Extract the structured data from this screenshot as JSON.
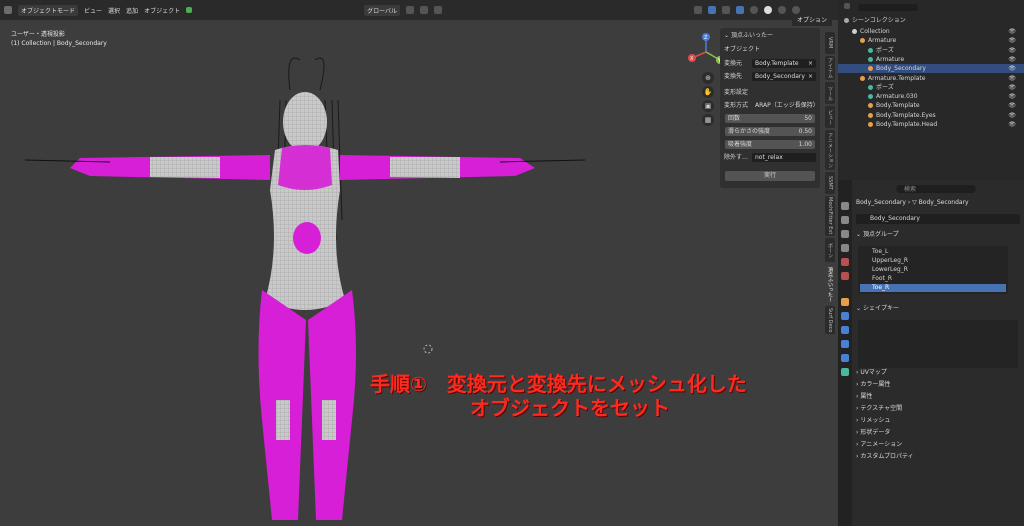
{
  "topbar": {
    "mode": "オブジェクトモード",
    "menus": [
      "ビュー",
      "選択",
      "追加",
      "オブジェクト"
    ],
    "transform": "グローバル",
    "options": "オプション"
  },
  "viewport": {
    "view_name": "ユーザー・透視投影",
    "collection_info": "(1) Collection | Body_Secondary"
  },
  "gizmo": {
    "z": "Z",
    "y": "Y",
    "x": "X"
  },
  "npanel": {
    "header": "頂点ふいったー",
    "object_label": "オブジェクト",
    "source_label": "変換元",
    "source_value": "Body.Template",
    "target_label": "変換先",
    "target_value": "Body_Secondary",
    "deform_label": "変形設定",
    "method_label": "変形方式",
    "method_value": "ARAP（エッジ長保持）",
    "sliders": [
      {
        "label": "回数",
        "value": "50"
      },
      {
        "label": "滑らかさの強度",
        "value": "0.50"
      },
      {
        "label": "吸着強度",
        "value": "1.00"
      }
    ],
    "exclude_label": "除外す…",
    "exclude_value": "not_relax",
    "execute": "実行"
  },
  "sidetabs": [
    "VRM",
    "アイテム",
    "ツール",
    "ビュー",
    "アニメーション",
    "SSMT",
    "MochiFitter Ext",
    "ボーン",
    "頂点ふいったー",
    "Surf Deco"
  ],
  "caption": {
    "line1": "手順①　変換元と変換先にメッシュ化した",
    "line2": "オブジェクトをセット"
  },
  "outliner": {
    "title": "シーンコレクション",
    "rows": [
      {
        "label": "Collection",
        "indent": 1,
        "color": "#d0d0d0"
      },
      {
        "label": "Armature",
        "indent": 2,
        "color": "#e6a04a"
      },
      {
        "label": "ポーズ",
        "indent": 3,
        "color": "#4ab8a0"
      },
      {
        "label": "Armature",
        "indent": 3,
        "color": "#4ab8a0"
      },
      {
        "label": "Body_Secondary",
        "indent": 3,
        "color": "#e6a04a",
        "selected": true
      },
      {
        "label": "Armature.Template",
        "indent": 2,
        "color": "#e6a04a"
      },
      {
        "label": "ポーズ",
        "indent": 3,
        "color": "#4ab8a0"
      },
      {
        "label": "Armature.030",
        "indent": 3,
        "color": "#4ab8a0"
      },
      {
        "label": "Body.Template",
        "indent": 3,
        "color": "#e6a04a"
      },
      {
        "label": "Body.Template.Eyes",
        "indent": 3,
        "color": "#e6a04a"
      },
      {
        "label": "Body.Template.Head",
        "indent": 3,
        "color": "#e6a04a"
      }
    ]
  },
  "properties": {
    "search_placeholder": "検索",
    "breadcrumb_obj": "Body_Secondary",
    "breadcrumb_data": "Body_Secondary",
    "mesh_name": "Body_Secondary",
    "vg_title": "頂点グループ",
    "vertex_groups": [
      "Toe_L",
      "UpperLeg_R",
      "LowerLeg_R",
      "Foot_R",
      "Toe_R"
    ],
    "shapekey_title": "シェイプキー",
    "sections": [
      "UVマップ",
      "カラー属性",
      "属性",
      "テクスチャ空間",
      "リメッシュ",
      "形状データ",
      "アニメーション",
      "カスタムプロパティ"
    ]
  },
  "colors": {
    "accent": "#4772b3",
    "caption": "#ff2a1e",
    "mesh_pink": "#d61fd6",
    "mesh_grey": "#c8c8c8"
  }
}
